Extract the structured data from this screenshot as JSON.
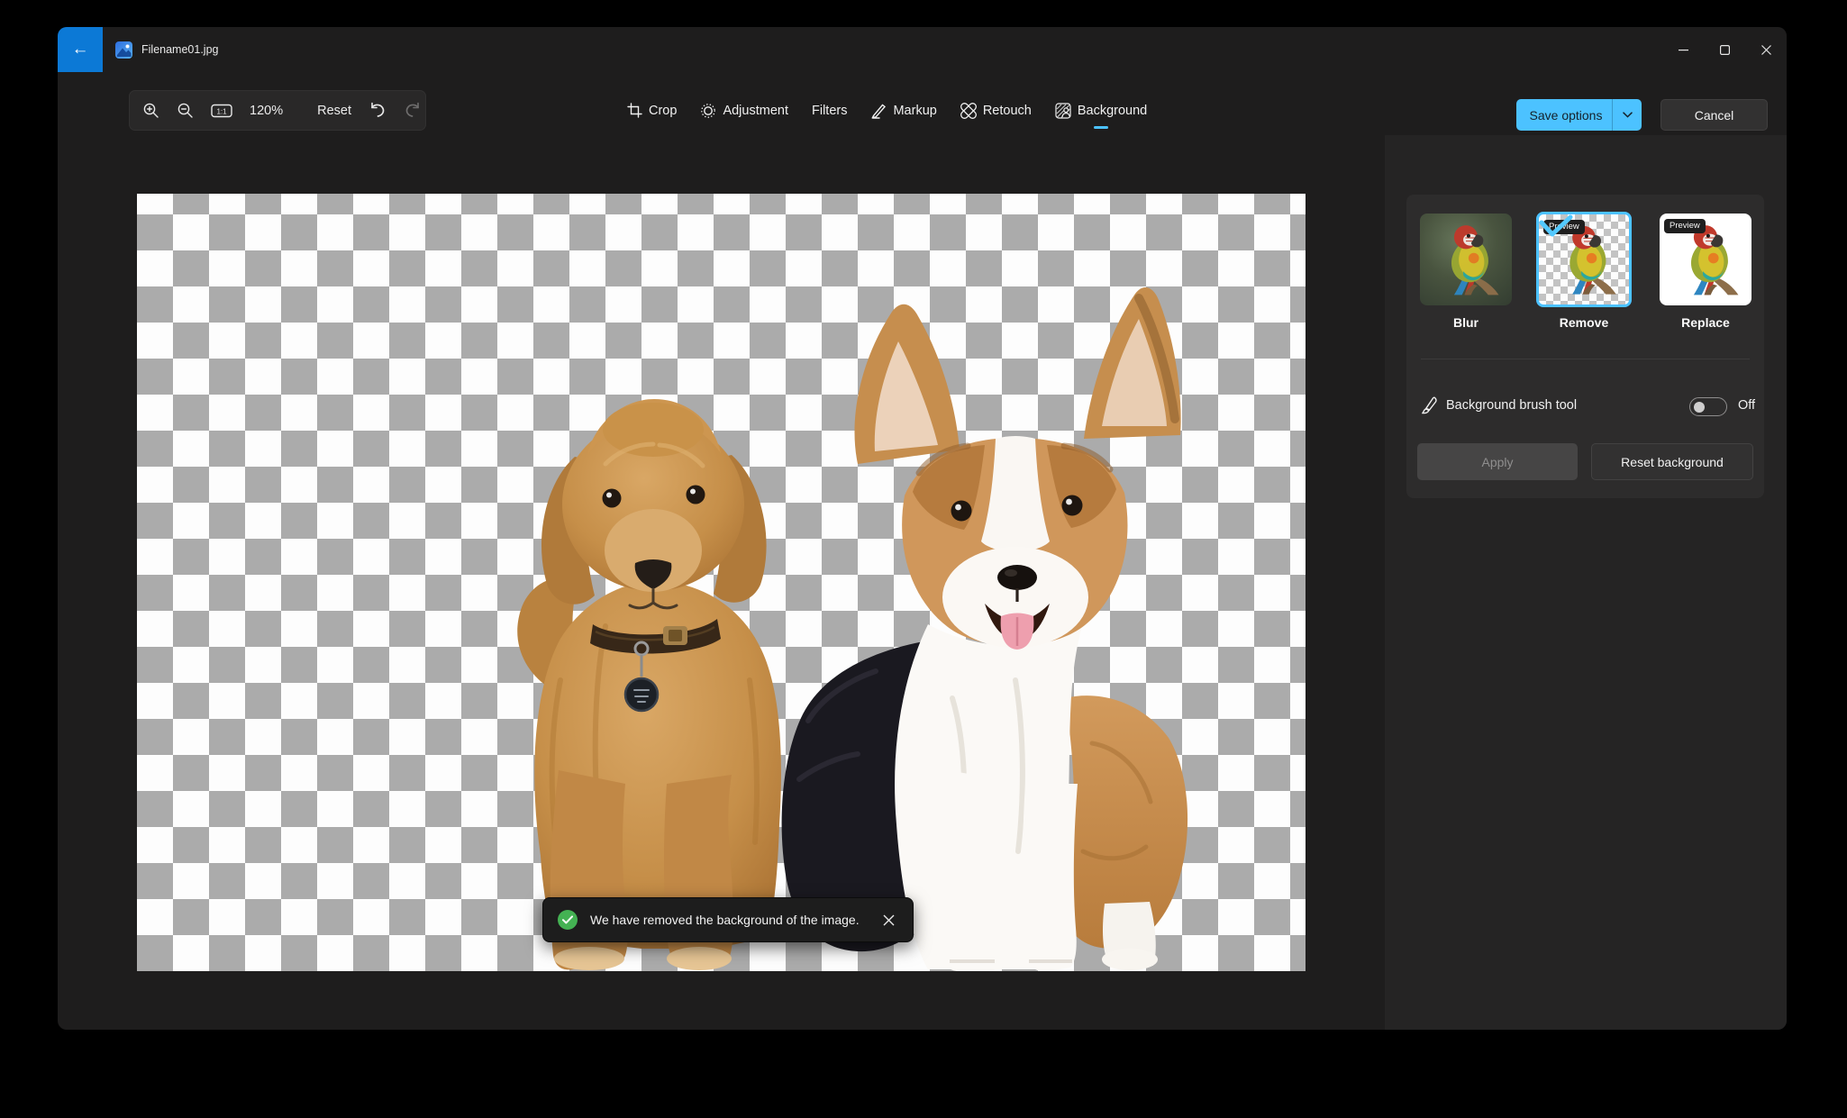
{
  "titlebar": {
    "filename": "Filename01.jpg",
    "back_glyph": "←"
  },
  "toolbar": {
    "zoom_level": "120%",
    "actual_size_label": "1:1",
    "reset": "Reset"
  },
  "tabs": [
    {
      "label": "Crop",
      "active": false
    },
    {
      "label": "Adjustment",
      "active": false
    },
    {
      "label": "Filters",
      "active": false
    },
    {
      "label": "Markup",
      "active": false
    },
    {
      "label": "Retouch",
      "active": false
    },
    {
      "label": "Background",
      "active": true
    }
  ],
  "actions": {
    "save": "Save options",
    "cancel": "Cancel"
  },
  "panel": {
    "options": [
      {
        "label": "Blur",
        "selected": false
      },
      {
        "label": "Remove",
        "badge": "Preview",
        "selected": true
      },
      {
        "label": "Replace",
        "badge": "Preview",
        "selected": false
      }
    ],
    "brush_label": "Background brush tool",
    "brush_state": "Off",
    "apply": "Apply",
    "reset_background": "Reset background"
  },
  "toast": {
    "message": "We have removed the background of the image."
  },
  "colors": {
    "accent": "#4cc2ff",
    "back_button_blue": "#0c79d6",
    "success_green": "#44b253",
    "checker_gray": "#ababab"
  }
}
